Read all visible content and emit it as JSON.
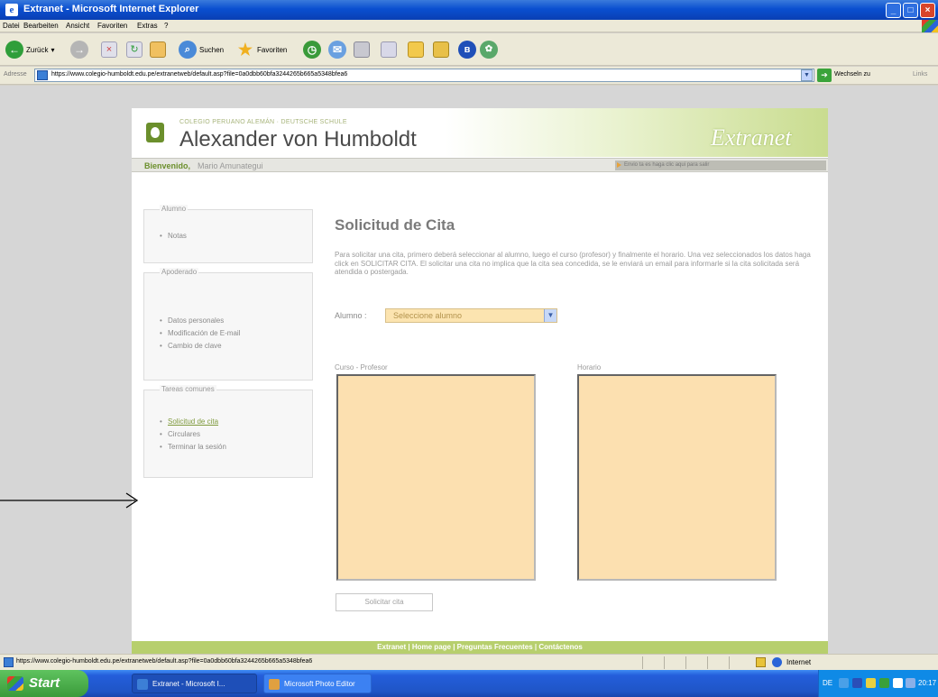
{
  "window": {
    "title": "Extranet - Microsoft Internet Explorer"
  },
  "menu": [
    "Datei",
    "Bearbeiten",
    "Ansicht",
    "Favoriten",
    "Extras",
    "?"
  ],
  "toolbar": {
    "back_label": "Zurück",
    "search_label": "Suchen",
    "favorites_label": "Favoriten"
  },
  "address_bar": {
    "label": "Adresse",
    "url": "https://www.colegio-humboldt.edu.pe/extranetweb/default.asp?file=0a0dbb60bfa3244265b665a5348bfea6",
    "go_label": "Wechseln zu",
    "links_label": "Links"
  },
  "site": {
    "school_subtitle": "COLEGIO PERUANO ALEMÁN · DEUTSCHE SCHULE",
    "school_name": "Alexander von Humboldt",
    "brand": "Extranet",
    "welcome_label": "Bienvenido,",
    "welcome_name": "Mario Amunategui",
    "welcome_note": "Envio ta es haga clic aqui para salir"
  },
  "sidebar": {
    "alumno": {
      "title": "Alumno",
      "items": [
        "Notas"
      ]
    },
    "apoderado": {
      "title": "Apoderado",
      "items": [
        "Datos personales",
        "Modificación de E-mail",
        "Cambio de clave"
      ]
    },
    "tareas": {
      "title": "Tareas comunes",
      "items": [
        "Solicitud de cita",
        "Circulares",
        "Terminar la sesión"
      ]
    }
  },
  "main": {
    "title": "Solicitud de Cita",
    "intro": "Para solicitar una cita, primero deberá seleccionar al alumno, luego el curso (profesor) y finalmente el horario. Una vez seleccionados los datos haga click en SOLICITAR CITA. El solicitar una cita no implica que la cita sea concedida, se le enviará un email para informarle si la cita solicitada será atendida o postergada.",
    "alumno_label": "Alumno :",
    "alumno_select": "Seleccione alumno",
    "curso_label": "Curso - Profesor",
    "horario_label": "Horario",
    "submit_label": "Solicitar cita"
  },
  "footer": {
    "text": "Extranet | Home page | Preguntas Frecuentes | Contáctenos"
  },
  "statusbar": {
    "url": "https://www.colegio-humboldt.edu.pe/extranetweb/default.asp?file=0a0dbb60bfa3244265b665a5348bfea6",
    "zone": "Internet"
  },
  "taskbar": {
    "start": "Start",
    "tasks": [
      "Extranet - Microsoft I...",
      "Microsoft Photo Editor"
    ],
    "tray_lang": "DE",
    "clock": "20:17"
  },
  "colors": {
    "accent_green": "#b7cf6d",
    "field_fill": "#fce0b0",
    "link_green": "#7f9a3d"
  }
}
